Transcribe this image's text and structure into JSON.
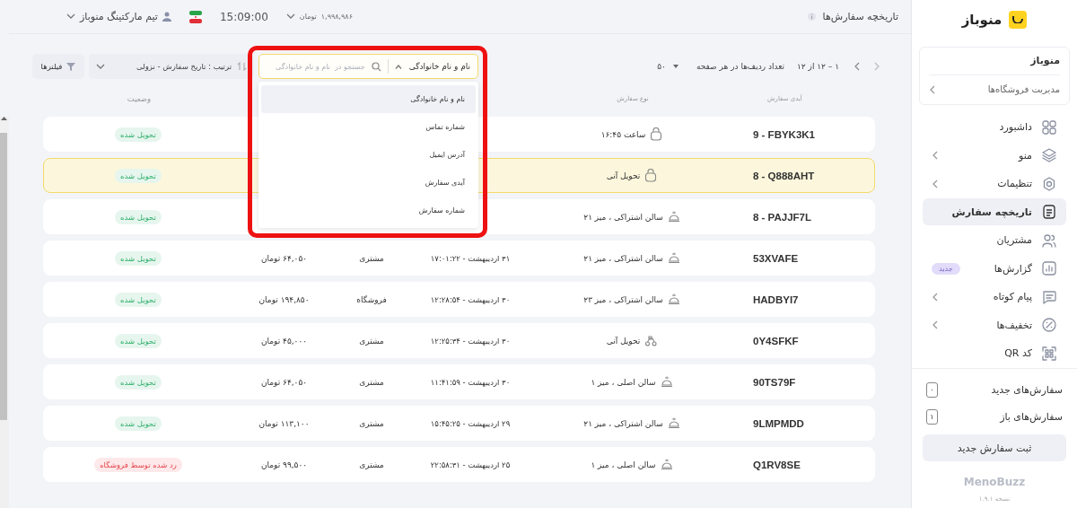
{
  "sidebar": {
    "logo": "منوباز",
    "store_card": {
      "title": "منوباز",
      "manage_link": "مدیریت فروشگاه‌ها"
    },
    "nav": [
      {
        "label": "داشبورد",
        "has_submenu": false,
        "selected": false
      },
      {
        "label": "منو",
        "has_submenu": true,
        "selected": false
      },
      {
        "label": "تنظیمات",
        "has_submenu": true,
        "selected": false
      },
      {
        "label": "تاریخچه سفارش",
        "has_submenu": false,
        "selected": true
      },
      {
        "label": "مشتریان",
        "has_submenu": false,
        "selected": false
      },
      {
        "label": "گزارش‌ها",
        "has_submenu": false,
        "selected": false,
        "badge": "جدید"
      },
      {
        "label": "پیام کوتاه",
        "has_submenu": true,
        "selected": false
      },
      {
        "label": "تخفیف‌ها",
        "has_submenu": true,
        "selected": false
      },
      {
        "label": "کد QR",
        "has_submenu": false,
        "selected": false
      }
    ],
    "order_counters": [
      {
        "label": "سفارش‌های جدید",
        "count": "۰"
      },
      {
        "label": "سفارش‌های باز",
        "count": "۱"
      }
    ],
    "new_order_button": "ثبت سفارش جدید",
    "brand": "MenoBuzz",
    "version": "نسخه ۱.۹.۱"
  },
  "top_bar": {
    "title": "تاریخچه سفارش‌ها",
    "balance": "۱,۹۹۸,۹۸۶",
    "currency": "تومان",
    "time": "15:09:00",
    "user": "تیم مارکتینگ منوباز"
  },
  "toolbar": {
    "range": "۱ – ۱۲ از ۱۲",
    "rows_per_page_label": "تعداد ردیف‌ها در هر صفحه",
    "rows_per_page": "۵۰",
    "search": {
      "field": "نام و نام خانوادگی",
      "placeholder": "جستجو در  نام و نام خانوادگی",
      "expanded": true,
      "highlighted": true,
      "options": [
        {
          "label": "نام و نام خانوادگی",
          "selected": true
        },
        {
          "label": "شماره تماس",
          "selected": false
        },
        {
          "label": "آدرس ایمیل",
          "selected": false
        },
        {
          "label": "آیدی سفارش",
          "selected": false
        },
        {
          "label": "شماره سفارش",
          "selected": false
        }
      ]
    },
    "sort": "ترتیب : تاریخ سفارش - نزولی",
    "filter": "فیلترها"
  },
  "table": {
    "columns": [
      {
        "label": "آیدی سفارش"
      },
      {
        "label": "نوع سفارش"
      },
      {
        "label": "وضعیت"
      }
    ],
    "rows": [
      {
        "id": "9 - FBYK3K1",
        "type": {
          "kind": "bag",
          "label": "ساعت ۱۶:۴۵"
        },
        "status": {
          "kind": "delivered",
          "label": "تحویل شده"
        },
        "selected": false
      },
      {
        "id": "8 - Q888AHT",
        "type": {
          "kind": "bag",
          "label": "تحویل آنی"
        },
        "status": {
          "kind": "delivered",
          "label": "تحویل شده"
        },
        "selected": true
      },
      {
        "id": "8 - PAJJF7L",
        "type": {
          "kind": "dine_in",
          "label": "سالن اشتراکی ، میز ۲۱"
        },
        "status": {
          "kind": "delivered",
          "label": "تحویل شده"
        },
        "selected": false
      },
      {
        "id": "53XVAFE",
        "type": {
          "kind": "dine_in",
          "label": "سالن اشتراکی ، میز ۲۱"
        },
        "date": "۳۱ اردیبهشت - ۱۷:۰۱:۲۲",
        "source": "مشتری",
        "price": "۶۴,۰۵۰ تومان",
        "status": {
          "kind": "delivered",
          "label": "تحویل شده"
        },
        "selected": false
      },
      {
        "id": "HADBYI7",
        "type": {
          "kind": "dine_in",
          "label": "سالن اشتراکی ، میز ۲۳"
        },
        "date": "۳۰ اردیبهشت - ۱۲:۲۸:۵۴",
        "source": "فروشگاه",
        "price": "۱۹۴,۸۵۰ تومان",
        "status": {
          "kind": "delivered",
          "label": "تحویل شده"
        },
        "selected": false
      },
      {
        "id": "0Y4SFKF",
        "type": {
          "kind": "delivery",
          "label": "تحویل آنی"
        },
        "date": "۳۰ اردیبهشت - ۱۲:۲۵:۳۴",
        "source": "مشتری",
        "price": "۴۵,۰۰۰ تومان",
        "status": {
          "kind": "delivered",
          "label": "تحویل شده"
        },
        "selected": false
      },
      {
        "id": "90TS79F",
        "type": {
          "kind": "dine_in",
          "label": "سالن اصلی ، میز ۱"
        },
        "date": "۳۰ اردیبهشت - ۱۱:۴۱:۵۹",
        "source": "مشتری",
        "price": "۶۴,۰۵۰ تومان",
        "status": {
          "kind": "delivered",
          "label": "تحویل شده"
        },
        "selected": false
      },
      {
        "id": "9LMPMDD",
        "type": {
          "kind": "dine_in",
          "label": "سالن اشتراکی ، میز ۲۱"
        },
        "date": "۲۹ اردیبهشت - ۱۵:۴۵:۲۵",
        "source": "مشتری",
        "price": "۱۱۳,۱۰۰ تومان",
        "status": {
          "kind": "delivered",
          "label": "تحویل شده"
        },
        "selected": false
      },
      {
        "id": "Q1RV8SE",
        "type": {
          "kind": "dine_in",
          "label": "سالن اصلی ، میز ۱"
        },
        "date": "۲۵ اردیبهشت - ۲۲:۵۸:۳۱",
        "source": "مشتری",
        "price": "۹۹,۵۰۰ تومان",
        "status": {
          "kind": "rejected",
          "label": "رد شده توسط فروشگاه"
        },
        "selected": false
      }
    ]
  }
}
